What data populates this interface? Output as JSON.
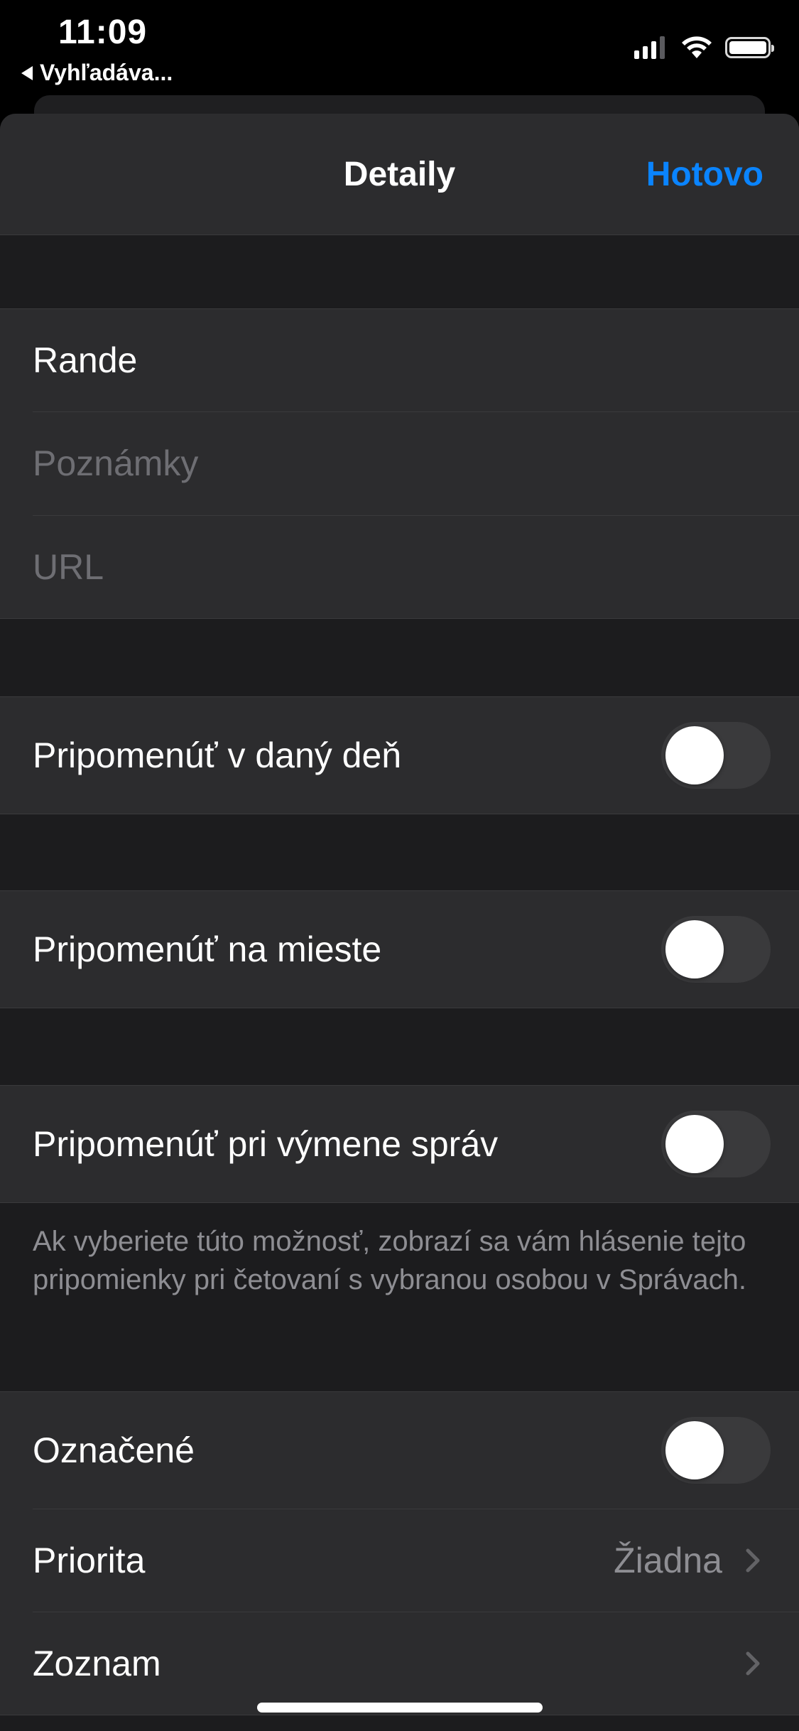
{
  "status_bar": {
    "time": "11:09",
    "back_app": "Vyhľadáva..."
  },
  "navbar": {
    "title": "Detaily",
    "done_label": "Hotovo"
  },
  "fields": {
    "title_value": "Rande",
    "notes_placeholder": "Poznámky",
    "url_placeholder": "URL"
  },
  "toggles": [
    {
      "label": "Pripomenúť v daný deň",
      "on": false
    },
    {
      "label": "Pripomenúť na mieste",
      "on": false
    },
    {
      "label": "Pripomenúť pri výmene správ",
      "on": false
    }
  ],
  "messages_note": "Ak vyberiete túto možnosť, zobrazí sa vám hlásenie tejto pripomienky pri četovaní s vybranou osobou v Správach.",
  "extras": {
    "flagged_label": "Označené",
    "flagged_on": false,
    "priority_label": "Priorita",
    "priority_value": "Žiadna",
    "list_label": "Zoznam"
  },
  "colors": {
    "accent": "#0a84ff",
    "background": "#1c1c1e",
    "cell": "#2c2c2e",
    "toggle_off": "#3a3a3c"
  },
  "icons": [
    "back-arrow-icon",
    "signal-icon",
    "wifi-icon",
    "battery-icon",
    "chevron-right-icon"
  ]
}
